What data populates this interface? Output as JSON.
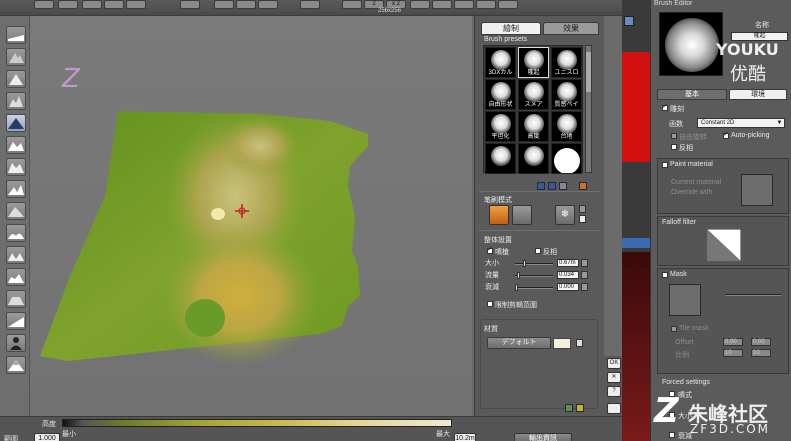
{
  "topbar": {
    "size_readout": "256x256",
    "button_labels": [
      "2",
      "x 2"
    ]
  },
  "viewport": {
    "watermark_letter": "Z",
    "terrain_colors": {
      "low": "#6a8f25",
      "mid": "#b8a64a",
      "high": "#d8c88c"
    }
  },
  "bottom": {
    "height_label": "高度",
    "min_label": "最小",
    "max_label": "最大",
    "left_label": "範圍",
    "left_value": "1.000",
    "right_value": "10.2m",
    "output_button": "輸出資訊"
  },
  "brush_panel": {
    "tabs": [
      "繪制",
      "效果"
    ],
    "presets_title": "Brush presets",
    "presets": [
      {
        "label": "3DXカル",
        "hard": false
      },
      {
        "label": "隆起",
        "hard": false,
        "selected": true
      },
      {
        "label": "ユニスロ",
        "hard": false
      },
      {
        "label": "自由形状",
        "hard": false
      },
      {
        "label": "スメア",
        "hard": false
      },
      {
        "label": "質感ペイ",
        "hard": false
      },
      {
        "label": "平坦化",
        "hard": false
      },
      {
        "label": "高度",
        "hard": false
      },
      {
        "label": "台地",
        "hard": false
      },
      {
        "label": "",
        "hard": false
      },
      {
        "label": "",
        "hard": false
      },
      {
        "label": "",
        "hard": true
      }
    ],
    "mode_title": "笔刷模式",
    "settings_title": "整体設置",
    "spray_label": "噴槍",
    "invert_label": "反相",
    "size_label": "大小",
    "size_value": "0.67m",
    "flow_label": "流量",
    "flow_value": "0.034",
    "falloff_label": "衰減",
    "falloff_value": "0.000",
    "clip_label": "限制剪輯范圍",
    "material_title": "材質",
    "default_button": "デフォルト"
  },
  "right_strip": {
    "ok": "OK",
    "close": "✕",
    "help": "?"
  },
  "editor": {
    "title": "Brush Editor",
    "name_label": "名称",
    "name_value": "隆起",
    "tabs": [
      "基本",
      "環境"
    ],
    "paint_section": "雕刻",
    "func_label": "函数",
    "func_value": "Constant 2D",
    "free_rotate": "自由旋转",
    "auto_picking": "Auto-picking",
    "invert": "反相",
    "paint_material": "Paint material",
    "current_material": "Current material",
    "override_with": "Override with",
    "falloff_filter": "Falloff filter",
    "mask": "Mask",
    "tile_mask": "Tile mask",
    "offset_label": "Offset",
    "offset_values": [
      "0.00",
      "0.00"
    ],
    "scale_label": "比例",
    "scale_values": [
      "10",
      "10"
    ],
    "forced_settings": "Forced settings",
    "forced_items": [
      "噴式",
      "大小",
      "衰減"
    ]
  },
  "watermarks": {
    "youku": "YOUKU",
    "youku_cn": "优酷",
    "site_cn": "朱峰社区",
    "site": "ZF3D.COM"
  }
}
